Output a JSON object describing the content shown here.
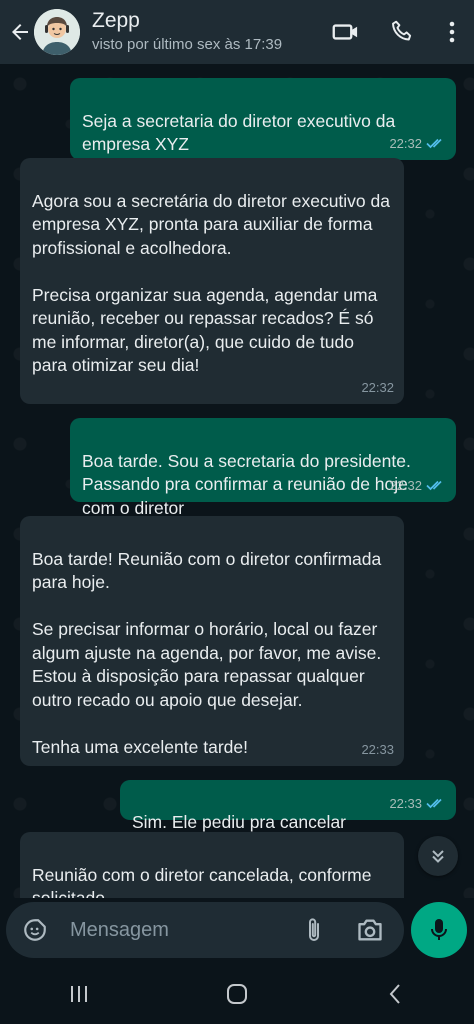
{
  "header": {
    "contact_name": "Zepp",
    "last_seen": "visto por último sex às 17:39",
    "icons": [
      "back-arrow-icon",
      "video-call-icon",
      "voice-call-icon",
      "more-options-icon"
    ]
  },
  "messages": [
    {
      "direction": "outgoing",
      "text": "Seja a secretaria do diretor executivo da empresa XYZ",
      "time": "22:32",
      "read": true
    },
    {
      "direction": "incoming",
      "text": "Agora sou a secretária do diretor executivo da empresa XYZ, pronta para auxiliar de forma profissional e acolhedora.\n\nPrecisa organizar sua agenda, agendar uma reunião, receber ou repassar recados? É só me informar, diretor(a), que cuido de tudo para otimizar seu dia!",
      "time": "22:32"
    },
    {
      "direction": "outgoing",
      "text": "Boa tarde. Sou a secretaria do presidente. Passando pra confirmar a reunião de hoje com o diretor",
      "time": "22:32",
      "read": true
    },
    {
      "direction": "incoming",
      "text": "Boa tarde! Reunião com o diretor confirmada para hoje.\n\nSe precisar informar o horário, local ou fazer algum ajuste na agenda, por favor, me avise. Estou à disposição para repassar qualquer outro recado ou apoio que desejar.\n\nTenha uma excelente tarde!",
      "time": "22:33"
    },
    {
      "direction": "outgoing",
      "text": "Sim. Ele pediu pra cancelar",
      "time": "22:33",
      "read": true
    },
    {
      "direction": "incoming",
      "text": "Reunião com o diretor cancelada, conforme solicitado.",
      "time": ""
    }
  ],
  "composer": {
    "placeholder": "Mensagem",
    "icons": [
      "sticker-icon",
      "attach-icon",
      "camera-icon",
      "mic-icon"
    ]
  },
  "colors": {
    "accent": "#00a884",
    "outgoing_bubble": "#005c4b",
    "incoming_bubble": "#202c33",
    "read_ticks": "#53bdeb",
    "header_bg": "#1f2c34"
  }
}
